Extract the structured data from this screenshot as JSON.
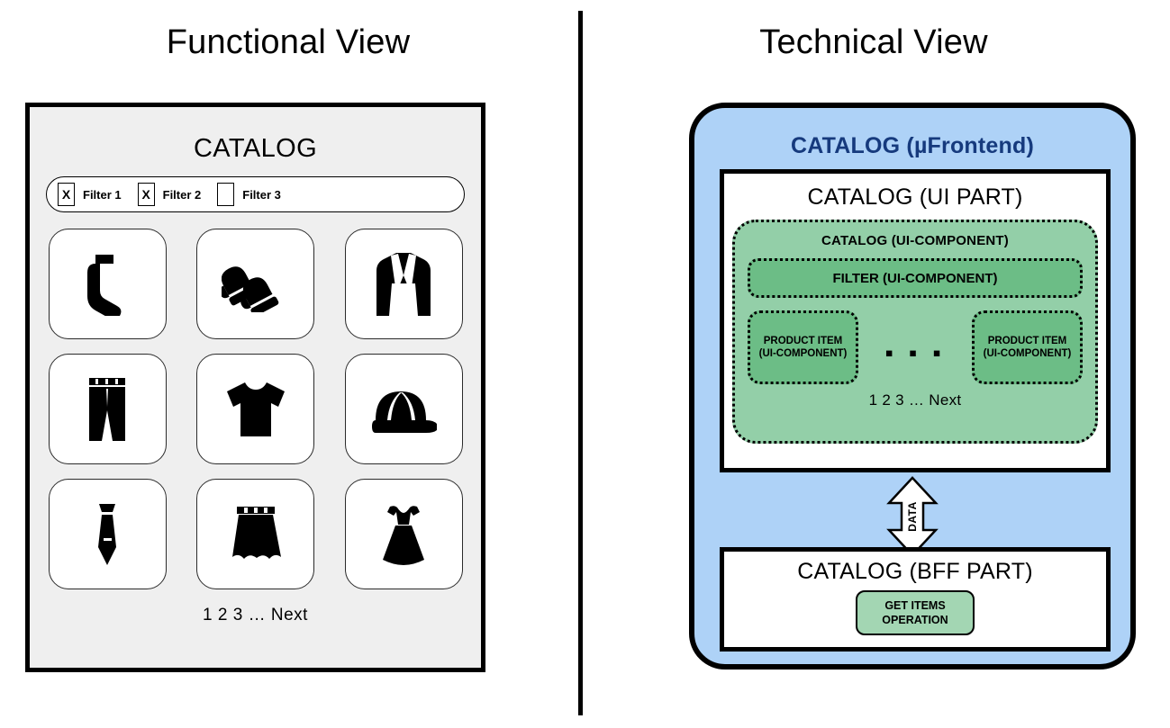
{
  "titles": {
    "functional": "Functional View",
    "technical": "Technical View"
  },
  "functional": {
    "catalog_heading": "CATALOG",
    "filters": [
      {
        "checked_mark": "X",
        "label": "Filter 1"
      },
      {
        "checked_mark": "X",
        "label": "Filter 2"
      },
      {
        "checked_mark": "",
        "label": "Filter 3"
      }
    ],
    "products": [
      {
        "icon": "sock-icon"
      },
      {
        "icon": "mittens-icon"
      },
      {
        "icon": "blazer-icon"
      },
      {
        "icon": "pants-icon"
      },
      {
        "icon": "tshirt-icon"
      },
      {
        "icon": "cap-icon"
      },
      {
        "icon": "tie-icon"
      },
      {
        "icon": "skirt-icon"
      },
      {
        "icon": "dress-icon"
      }
    ],
    "pagination": "1 2 3 … Next"
  },
  "technical": {
    "mfe_title": "CATALOG (µFrontend)",
    "ui_part_heading": "CATALOG (UI PART)",
    "catalog_ui_component": "CATALOG (UI-COMPONENT)",
    "filter_ui_component": "FILTER (UI-COMPONENT)",
    "product_item_left_line1": "PRODUCT ITEM",
    "product_item_left_line2": "(UI-COMPONENT)",
    "product_item_right_line1": "PRODUCT ITEM",
    "product_item_right_line2": "(UI-COMPONENT)",
    "ellipsis": "▪ ▪ ▪",
    "pagination": "1 2 3 … Next",
    "data_arrow_label": "DATA",
    "bff_part_heading": "CATALOG (BFF PART)",
    "operation_line1": "GET ITEMS",
    "operation_line2": "OPERATION"
  },
  "colors": {
    "mfe_background": "#aed2f7",
    "mfe_title_text": "#163a7d",
    "ui_component_outer_green": "#93cfa8",
    "ui_component_inner_green": "#6cbd86",
    "operation_green": "#a3d6b3",
    "mock_background": "#efefef",
    "border_black": "#000000"
  }
}
